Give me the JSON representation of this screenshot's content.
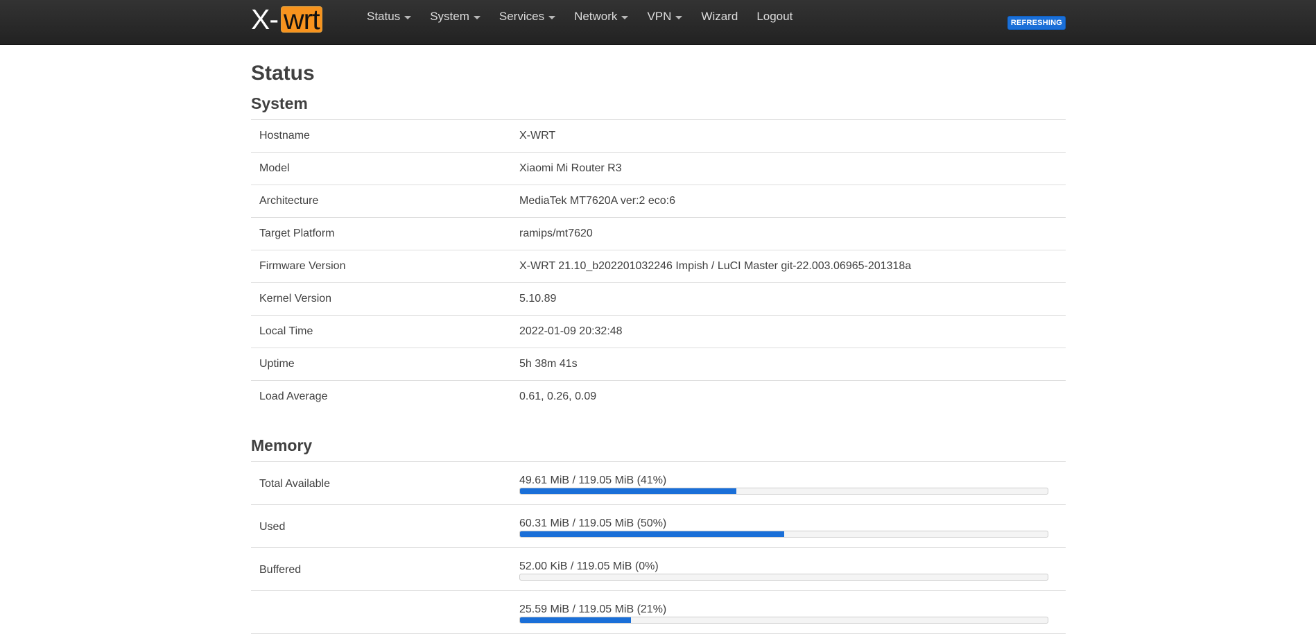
{
  "brand": {
    "left": "X-",
    "box": "wrt"
  },
  "menu": [
    {
      "label": "Status",
      "dropdown": true
    },
    {
      "label": "System",
      "dropdown": true
    },
    {
      "label": "Services",
      "dropdown": true
    },
    {
      "label": "Network",
      "dropdown": true
    },
    {
      "label": "VPN",
      "dropdown": true
    },
    {
      "label": "Wizard",
      "dropdown": false
    },
    {
      "label": "Logout",
      "dropdown": false
    }
  ],
  "badge": "REFRESHING",
  "page_title": "Status",
  "system": {
    "title": "System",
    "rows": [
      {
        "label": "Hostname",
        "value": "X-WRT"
      },
      {
        "label": "Model",
        "value": "Xiaomi Mi Router R3"
      },
      {
        "label": "Architecture",
        "value": "MediaTek MT7620A ver:2 eco:6"
      },
      {
        "label": "Target Platform",
        "value": "ramips/mt7620"
      },
      {
        "label": "Firmware Version",
        "value": "X-WRT 21.10_b202201032246 Impish / LuCI Master git-22.003.06965-201318a"
      },
      {
        "label": "Kernel Version",
        "value": "5.10.89"
      },
      {
        "label": "Local Time",
        "value": "2022-01-09 20:32:48"
      },
      {
        "label": "Uptime",
        "value": "5h 38m 41s"
      },
      {
        "label": "Load Average",
        "value": "0.61, 0.26, 0.09"
      }
    ]
  },
  "memory": {
    "title": "Memory",
    "rows": [
      {
        "label": "Total Available",
        "text": "49.61 MiB / 119.05 MiB (41%)",
        "percent": 41
      },
      {
        "label": "Used",
        "text": "60.31 MiB / 119.05 MiB (50%)",
        "percent": 50
      },
      {
        "label": "Buffered",
        "text": "52.00 KiB / 119.05 MiB (0%)",
        "percent": 0
      },
      {
        "label": "",
        "text": "25.59 MiB / 119.05 MiB (21%)",
        "percent": 21
      }
    ]
  },
  "colors": {
    "accent": "#1a6fd8",
    "brand_box": "#f7931e",
    "navbar": "#2b2b2b"
  }
}
